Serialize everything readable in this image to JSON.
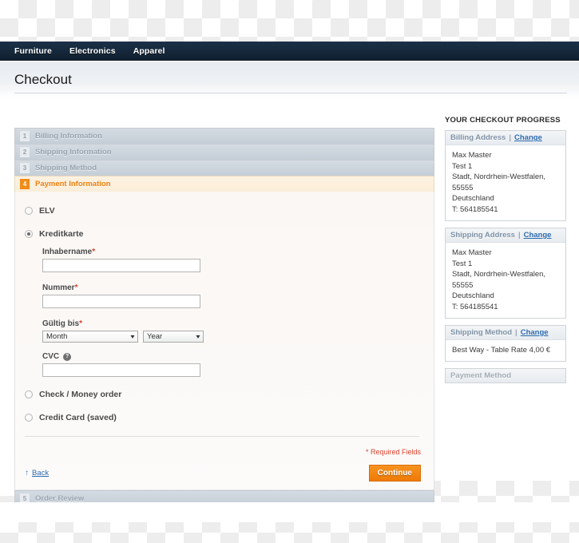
{
  "nav": {
    "items": [
      {
        "label": "Furniture"
      },
      {
        "label": "Electronics"
      },
      {
        "label": "Apparel"
      }
    ]
  },
  "page": {
    "title": "Checkout"
  },
  "checkout_steps": [
    {
      "num": "1",
      "title": "Billing Information",
      "state": "collapsed"
    },
    {
      "num": "2",
      "title": "Shipping Information",
      "state": "collapsed"
    },
    {
      "num": "3",
      "title": "Shipping Method",
      "state": "collapsed"
    },
    {
      "num": "4",
      "title": "Payment Information",
      "state": "active"
    },
    {
      "num": "5",
      "title": "Order Review",
      "state": "collapsed"
    }
  ],
  "payment": {
    "methods": [
      {
        "label": "ELV",
        "selected": false
      },
      {
        "label": "Kreditkarte",
        "selected": true
      },
      {
        "label": "Check / Money order",
        "selected": false
      },
      {
        "label": "Credit Card (saved)",
        "selected": false
      }
    ],
    "credit_card_form": {
      "name_label": "Inhabername",
      "name_value": "",
      "name_placeholder": "",
      "number_label": "Nummer",
      "number_value": "",
      "number_placeholder": "",
      "expiry_label": "Gültig bis",
      "month_value": "Month",
      "year_value": "Year",
      "cvc_label": "CVC",
      "cvc_value": "",
      "cvc_placeholder": "",
      "help_icon": "question-mark-icon",
      "required_marker": "*"
    },
    "required_note": "* Required Fields",
    "back_label": "Back",
    "back_icon": "arrow-up-icon",
    "continue_label": "Continue"
  },
  "sidebar": {
    "heading": "YOUR CHECKOUT PROGRESS",
    "change_label": "Change",
    "separator": "|",
    "blocks": [
      {
        "title": "Billing Address",
        "has_change": true,
        "lines": [
          "Max Master",
          "Test 1",
          "Stadt, Nordrhein-Westfalen,",
          "55555",
          "Deutschland",
          "T: 564185541"
        ]
      },
      {
        "title": "Shipping Address",
        "has_change": true,
        "lines": [
          "Max Master",
          "Test 1",
          "Stadt, Nordrhein-Westfalen,",
          "55555",
          "Deutschland",
          "T: 564185541"
        ]
      },
      {
        "title": "Shipping Method",
        "has_change": true,
        "lines": [
          "Best Way - Table Rate 4,00 €"
        ]
      },
      {
        "title": "Payment Method",
        "has_change": false,
        "lines": []
      }
    ]
  },
  "colors": {
    "nav_bg": "#16293c",
    "accent_orange": "#ee7e0e",
    "link_blue": "#2f6cb0",
    "required_red": "#d9412c",
    "step_gray": "#9aa6b1"
  }
}
